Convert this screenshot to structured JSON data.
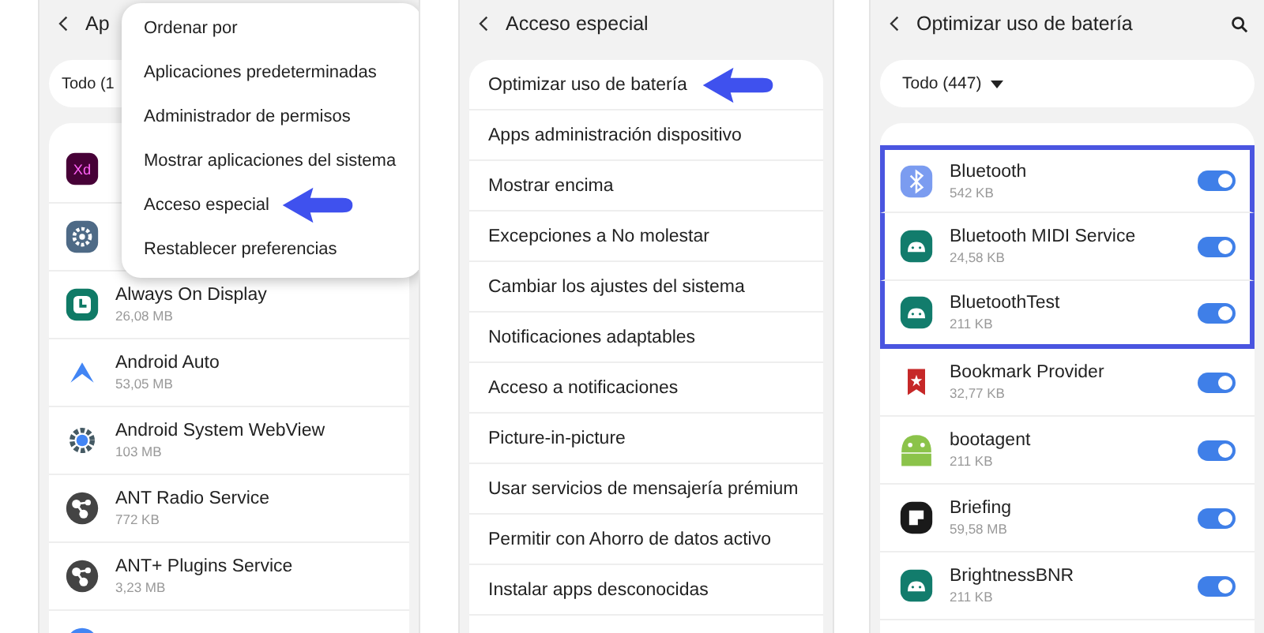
{
  "apps_panel": {
    "title": "Ap",
    "filter": "Todo (1",
    "apps": [
      {
        "kind": "xd",
        "icon_label": "Xd"
      },
      {
        "kind": "gear"
      },
      {
        "kind": "clock",
        "name": "Always On Display",
        "size": "26,08 MB"
      },
      {
        "kind": "auto",
        "name": "Android Auto",
        "size": "53,05 MB"
      },
      {
        "kind": "webview",
        "name": "Android System WebView",
        "size": "103 MB"
      },
      {
        "kind": "ant",
        "name": "ANT Radio Service",
        "size": "772 KB"
      },
      {
        "kind": "ant",
        "name": "ANT+ Plugins Service",
        "size": "3,23 MB"
      },
      {
        "kind": "ar"
      }
    ],
    "menu": [
      {
        "label": "Ordenar por",
        "pointed": false
      },
      {
        "label": "Aplicaciones predeterminadas",
        "pointed": false
      },
      {
        "label": "Administrador de permisos",
        "pointed": false
      },
      {
        "label": "Mostrar aplicaciones del sistema",
        "pointed": false
      },
      {
        "label": "Acceso especial",
        "pointed": true
      },
      {
        "label": "Restablecer preferencias",
        "pointed": false
      }
    ]
  },
  "special_access_panel": {
    "title": "Acceso especial",
    "items": [
      {
        "label": "Optimizar uso de batería",
        "pointed": true
      },
      {
        "label": "Apps administración dispositivo",
        "pointed": false
      },
      {
        "label": "Mostrar encima",
        "pointed": false
      },
      {
        "label": "Excepciones a No molestar",
        "pointed": false
      },
      {
        "label": "Cambiar los ajustes del sistema",
        "pointed": false
      },
      {
        "label": "Notificaciones adaptables",
        "pointed": false
      },
      {
        "label": "Acceso a notificaciones",
        "pointed": false
      },
      {
        "label": "Picture-in-picture",
        "pointed": false
      },
      {
        "label": "Usar servicios de mensajería prémium",
        "pointed": false
      },
      {
        "label": "Permitir con Ahorro de datos activo",
        "pointed": false
      },
      {
        "label": "Instalar apps desconocidas",
        "pointed": false
      }
    ]
  },
  "battery_panel": {
    "title": "Optimizar uso de batería",
    "filter": "Todo (447)",
    "apps": [
      {
        "kind": "bluetooth",
        "name": "Bluetooth",
        "size": "542 KB",
        "on": true,
        "highlighted": true
      },
      {
        "kind": "android",
        "name": "Bluetooth MIDI Service",
        "size": "24,58 KB",
        "on": true,
        "highlighted": true
      },
      {
        "kind": "android",
        "name": "BluetoothTest",
        "size": "211 KB",
        "on": true,
        "highlighted": true
      },
      {
        "kind": "bookmark",
        "name": "Bookmark Provider",
        "size": "32,77 KB",
        "on": true,
        "highlighted": false
      },
      {
        "kind": "android_green",
        "name": "bootagent",
        "size": "211 KB",
        "on": true,
        "highlighted": false
      },
      {
        "kind": "briefing",
        "name": "Briefing",
        "size": "59,58 MB",
        "on": true,
        "highlighted": false
      },
      {
        "kind": "android",
        "name": "BrightnessBNR",
        "size": "211 KB",
        "on": true,
        "highlighted": false
      }
    ]
  }
}
